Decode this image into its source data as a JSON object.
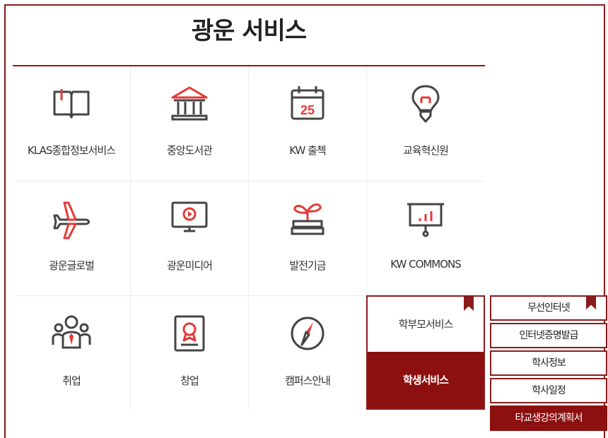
{
  "title": "광운 서비스",
  "colors": {
    "accent": "#8c1b1b",
    "icon": "#444444",
    "icon_accent": "#e53935"
  },
  "services": [
    {
      "label": "KLAS종합정보서비스",
      "icon": "open-book-icon"
    },
    {
      "label": "중앙도서관",
      "icon": "library-building-icon"
    },
    {
      "label": "KW 출첵",
      "icon": "calendar-25-icon",
      "icon_text": "25"
    },
    {
      "label": "교육혁신원",
      "icon": "lightbulb-icon"
    },
    {
      "label": "광운글로벌",
      "icon": "airplane-icon"
    },
    {
      "label": "광운미디어",
      "icon": "monitor-play-icon"
    },
    {
      "label": "발전기금",
      "icon": "sprout-books-icon"
    },
    {
      "label": "KW COMMONS",
      "icon": "presentation-board-icon"
    },
    {
      "label": "취업",
      "icon": "people-tie-icon"
    },
    {
      "label": "창업",
      "icon": "certificate-icon"
    },
    {
      "label": "캠퍼스안내",
      "icon": "compass-icon"
    }
  ],
  "service_box": {
    "parent_label": "학부모서비스",
    "student_label": "학생서비스"
  },
  "student_submenu": [
    {
      "label": "무선인터넷",
      "active": false
    },
    {
      "label": "인터넷증명발급",
      "active": false
    },
    {
      "label": "학사정보",
      "active": false
    },
    {
      "label": "학사일정",
      "active": false
    },
    {
      "label": "타교생강의계획서",
      "active": true
    }
  ]
}
